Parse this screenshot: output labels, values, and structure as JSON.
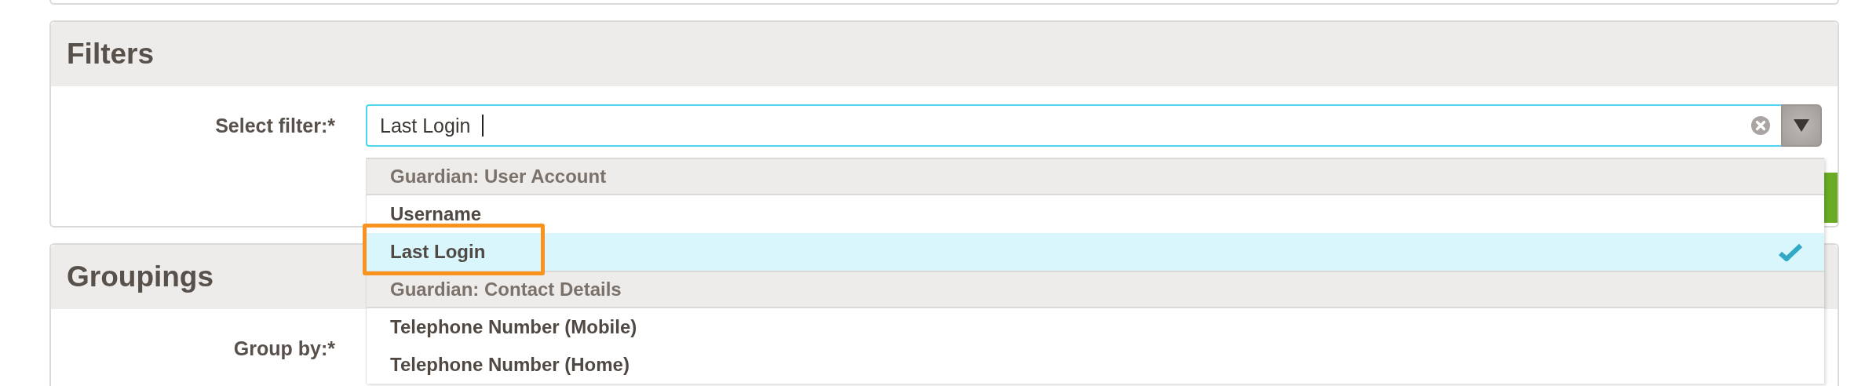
{
  "filters": {
    "title": "Filters",
    "label": "Select filter:*",
    "value": "Last Login"
  },
  "dropdown": {
    "options": [
      {
        "kind": "group",
        "label": "Guardian: User Account"
      },
      {
        "kind": "option",
        "label": "Username",
        "selected": false,
        "annotated": false
      },
      {
        "kind": "option",
        "label": "Last Login",
        "selected": true,
        "annotated": true
      },
      {
        "kind": "group",
        "label": "Guardian: Contact Details"
      },
      {
        "kind": "option",
        "label": "Telephone Number (Mobile)",
        "selected": false,
        "annotated": false
      },
      {
        "kind": "option",
        "label": "Telephone Number (Home)",
        "selected": false,
        "annotated": false
      }
    ]
  },
  "groupings": {
    "title": "Groupings",
    "label": "Group by:*"
  }
}
